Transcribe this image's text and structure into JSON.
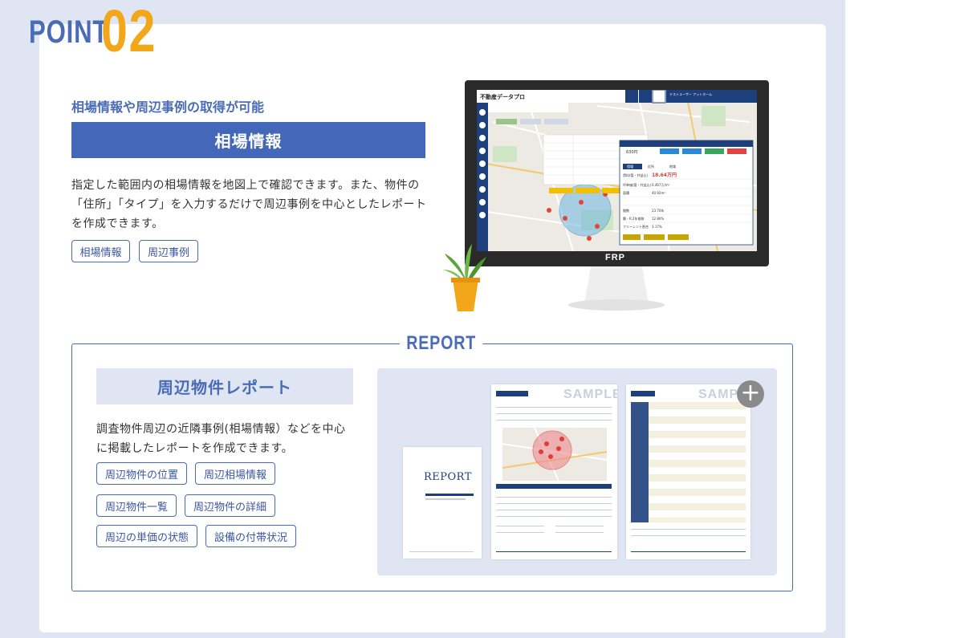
{
  "point": {
    "word": "POINT",
    "number": "02"
  },
  "section1": {
    "subheading": "相場情報や周辺事例の取得が可能",
    "bar_title": "相場情報",
    "description": "指定した範囲内の相場情報を地図上で確認できます。また、物件の「住所」「タイプ」を入力するだけで周辺事例を中心としたレポートを作成できます。",
    "tags": [
      "相場情報",
      "周辺事例"
    ]
  },
  "monitor": {
    "brand": "FRP",
    "app_title": "不動産データプロ",
    "user_label": "テストユーザー アットホーム",
    "popup": {
      "price": "630円",
      "tabs": [
        "相場",
        "近所",
        "地域"
      ],
      "rows": [
        {
          "label": "賃料(管・共益込)",
          "value": "18.64万円"
        },
        {
          "label": "坪単価(管・共益込)",
          "value": "0.467万/m²"
        },
        {
          "label": "面積",
          "value": "40.92m²"
        },
        {
          "label": "間数",
          "value": "23.70年"
        },
        {
          "label": "築・R.2年推移",
          "value": "12.80%"
        },
        {
          "label": "フリーレント割合",
          "value": "3.17%"
        }
      ]
    }
  },
  "report": {
    "label": "REPORT",
    "title": "周辺物件レポート",
    "description": "調査物件周辺の近隣事例(相場情報）などを中心に掲載したレポートを作成できます。",
    "tags": [
      "周辺物件の位置",
      "周辺相場情報",
      "周辺物件一覧",
      "周辺物件の詳細",
      "周辺の単価の状態",
      "設備の付帯状況"
    ],
    "sample_label": "SAMPLE",
    "cover_logo": "REPORT",
    "expand_symbol": "+"
  },
  "colors": {
    "accent": "#4468b9",
    "orange": "#f2a71b",
    "band": "#dfe5f3"
  }
}
